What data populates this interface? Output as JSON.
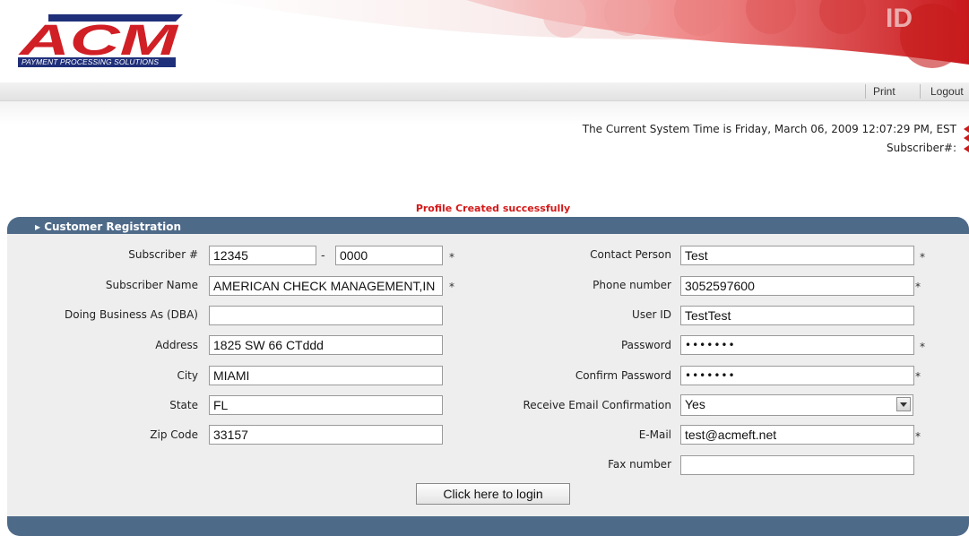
{
  "brand": {
    "logo_text": "ACM",
    "tagline": "PAYMENT PROCESSING SOLUTIONS",
    "colors": {
      "red": "#cc1b1b",
      "navy": "#1f2f7a",
      "panel": "#4e6a89"
    }
  },
  "nav": {
    "print": "Print",
    "logout": "Logout"
  },
  "info": {
    "system_time": "The Current System Time is Friday, March 06, 2009 12:07:29 PM, EST",
    "subscriber_label": "Subscriber#:"
  },
  "status": {
    "message": "Profile Created successfully"
  },
  "panel": {
    "title": "▸ Customer Registration"
  },
  "form": {
    "required_mark": "*",
    "dash": "-",
    "left": {
      "subscriber": {
        "label": "Subscriber #",
        "value": "12345",
        "value2": "0000"
      },
      "subscriber_name": {
        "label": "Subscriber Name",
        "value": "AMERICAN CHECK MANAGEMENT,IN"
      },
      "dba": {
        "label": "Doing Business As (DBA)",
        "value": ""
      },
      "address": {
        "label": "Address",
        "value": "1825 SW 66 CTddd"
      },
      "city": {
        "label": "City",
        "value": "MIAMI"
      },
      "state": {
        "label": "State",
        "value": "FL"
      },
      "zip": {
        "label": "Zip Code",
        "value": "33157"
      }
    },
    "right": {
      "contact": {
        "label": "Contact Person",
        "value": "Test"
      },
      "phone": {
        "label": "Phone number",
        "value": "3052597600"
      },
      "userid": {
        "label": "User ID",
        "value": "TestTest"
      },
      "password": {
        "label": "Password",
        "value": "•••••••"
      },
      "confirm": {
        "label": "Confirm Password",
        "value": "•••••••"
      },
      "email_confirm": {
        "label": "Receive Email Confirmation",
        "value": "Yes"
      },
      "email": {
        "label": "E-Mail",
        "value": "test@acmeft.net"
      },
      "fax": {
        "label": "Fax number",
        "value": ""
      }
    },
    "login_button": "Click here to login"
  }
}
